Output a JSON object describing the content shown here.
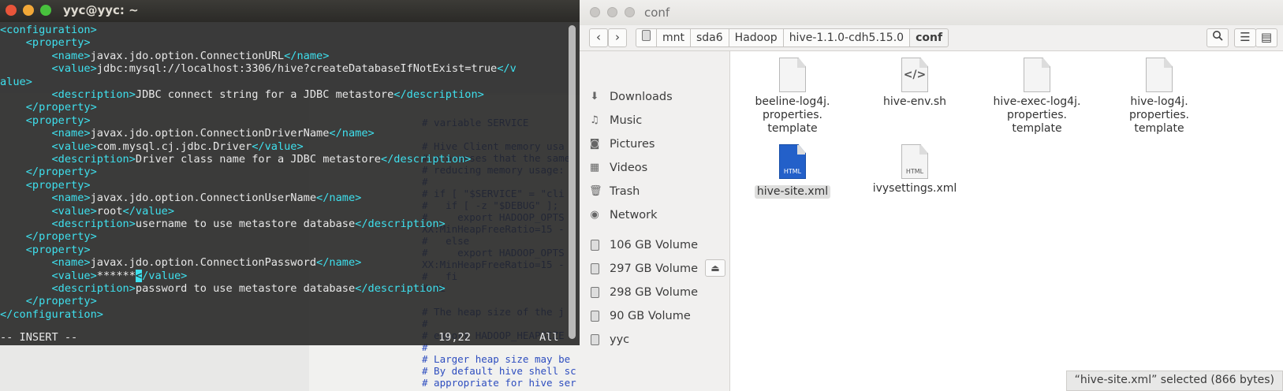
{
  "terminal": {
    "title": "yyc@yyc: ~",
    "lines": [
      {
        "parts": [
          [
            "tag",
            "<configuration>"
          ]
        ]
      },
      {
        "parts": [
          [
            "txt",
            "    "
          ],
          [
            "tag",
            "<property>"
          ]
        ]
      },
      {
        "parts": [
          [
            "txt",
            "        "
          ],
          [
            "tag",
            "<name>"
          ],
          [
            "txt",
            "javax.jdo.option.ConnectionURL"
          ],
          [
            "tag",
            "</name>"
          ]
        ]
      },
      {
        "parts": [
          [
            "txt",
            "        "
          ],
          [
            "tag",
            "<value>"
          ],
          [
            "txt",
            "jdbc:mysql://localhost:3306/hive?createDatabaseIfNotExist=true"
          ],
          [
            "tag",
            "</v"
          ]
        ]
      },
      {
        "parts": [
          [
            "tag",
            "alue>"
          ]
        ]
      },
      {
        "parts": [
          [
            "txt",
            "        "
          ],
          [
            "tag",
            "<description>"
          ],
          [
            "txt",
            "JDBC connect string for a JDBC metastore"
          ],
          [
            "tag",
            "</description>"
          ]
        ]
      },
      {
        "parts": [
          [
            "txt",
            "    "
          ],
          [
            "tag",
            "</property>"
          ]
        ]
      },
      {
        "parts": [
          [
            "txt",
            "    "
          ],
          [
            "tag",
            "<property>"
          ]
        ]
      },
      {
        "parts": [
          [
            "txt",
            "        "
          ],
          [
            "tag",
            "<name>"
          ],
          [
            "txt",
            "javax.jdo.option.ConnectionDriverName"
          ],
          [
            "tag",
            "</name>"
          ]
        ]
      },
      {
        "parts": [
          [
            "txt",
            "        "
          ],
          [
            "tag",
            "<value>"
          ],
          [
            "txt",
            "com.mysql.cj.jdbc.Driver"
          ],
          [
            "tag",
            "</value>"
          ]
        ]
      },
      {
        "parts": [
          [
            "txt",
            "        "
          ],
          [
            "tag",
            "<description>"
          ],
          [
            "txt",
            "Driver class name for a JDBC metastore"
          ],
          [
            "tag",
            "</description>"
          ]
        ]
      },
      {
        "parts": [
          [
            "txt",
            "    "
          ],
          [
            "tag",
            "</property>"
          ]
        ]
      },
      {
        "parts": [
          [
            "txt",
            "    "
          ],
          [
            "tag",
            "<property>"
          ]
        ]
      },
      {
        "parts": [
          [
            "txt",
            "        "
          ],
          [
            "tag",
            "<name>"
          ],
          [
            "txt",
            "javax.jdo.option.ConnectionUserName"
          ],
          [
            "tag",
            "</name>"
          ]
        ]
      },
      {
        "parts": [
          [
            "txt",
            "        "
          ],
          [
            "tag",
            "<value>"
          ],
          [
            "txt",
            "root"
          ],
          [
            "tag",
            "</value>"
          ]
        ]
      },
      {
        "parts": [
          [
            "txt",
            "        "
          ],
          [
            "tag",
            "<description>"
          ],
          [
            "txt",
            "username to use metastore database"
          ],
          [
            "tag",
            "</description>"
          ]
        ]
      },
      {
        "parts": [
          [
            "txt",
            "    "
          ],
          [
            "tag",
            "</property>"
          ]
        ]
      },
      {
        "parts": [
          [
            "txt",
            "    "
          ],
          [
            "tag",
            "<property>"
          ]
        ]
      },
      {
        "parts": [
          [
            "txt",
            "        "
          ],
          [
            "tag",
            "<name>"
          ],
          [
            "txt",
            "javax.jdo.option.ConnectionPassword"
          ],
          [
            "tag",
            "</name>"
          ]
        ]
      },
      {
        "parts": [
          [
            "txt",
            "        "
          ],
          [
            "tag",
            "<value>"
          ],
          [
            "txt",
            "******"
          ],
          [
            "cur",
            "<"
          ],
          [
            "tag",
            "/value>"
          ]
        ]
      },
      {
        "parts": [
          [
            "txt",
            "        "
          ],
          [
            "tag",
            "<description>"
          ],
          [
            "txt",
            "password to use metastore database"
          ],
          [
            "tag",
            "</description>"
          ]
        ]
      },
      {
        "parts": [
          [
            "txt",
            "    "
          ],
          [
            "tag",
            "</property>"
          ]
        ]
      },
      {
        "parts": [
          [
            "tag",
            "</configuration>"
          ]
        ]
      }
    ],
    "mode": "-- INSERT --",
    "position": "19,22",
    "scroll": "All"
  },
  "editor_bg_lines": [
    "# variable SERVICE",
    "",
    "# Hive Client memory usa",
    "# processes that the same",
    "# reducing memory usage:",
    "#",
    "# if [ \"$SERVICE\" = \"cli",
    "#   if [ -z \"$DEBUG\" ];",
    "#     export HADOOP_OPTS",
    "XX:MinHeapFreeRatio=15 -",
    "#   else",
    "#     export HADOOP_OPTS",
    "XX:MinHeapFreeRatio=15 -",
    "#   fi",
    "# fi",
    "",
    "# The heap size of the j",
    "#",
    "# export HADOOP_HEAPSIZE",
    "#",
    "# Larger heap size may be",
    "# By default hive shell sc",
    "# appropriate for hive ser"
  ],
  "file_manager": {
    "title": "conf",
    "breadcrumbs": [
      "mnt",
      "sda6",
      "Hadoop",
      "hive-1.1.0-cdh5.15.0",
      "conf"
    ],
    "sidebar": [
      {
        "icon": "download-icon",
        "glyph": "⬇",
        "label": "Downloads"
      },
      {
        "icon": "music-icon",
        "glyph": "♫",
        "label": "Music"
      },
      {
        "icon": "camera-icon",
        "glyph": "◙",
        "label": "Pictures"
      },
      {
        "icon": "video-icon",
        "glyph": "▦",
        "label": "Videos"
      },
      {
        "icon": "trash-icon",
        "glyph": "🗑",
        "label": "Trash"
      },
      {
        "icon": "network-icon",
        "glyph": "◉",
        "label": "Network"
      },
      {
        "icon": "drive-icon",
        "label": "106 GB Volume"
      },
      {
        "icon": "drive-icon",
        "label": "297 GB Volume"
      },
      {
        "icon": "drive-icon",
        "label": "298 GB Volume"
      },
      {
        "icon": "drive-icon",
        "label": "90 GB Volume"
      },
      {
        "icon": "drive-icon",
        "label": "yyc"
      }
    ],
    "files": [
      {
        "name": "beeline-log4j.\nproperties.\ntemplate",
        "kind": "text",
        "tag": ""
      },
      {
        "name": "hive-env.sh",
        "kind": "script",
        "tag": "</>"
      },
      {
        "name": "hive-exec-log4j.\nproperties.\ntemplate",
        "kind": "text",
        "tag": ""
      },
      {
        "name": "hive-log4j.\nproperties.\ntemplate",
        "kind": "text",
        "tag": ""
      },
      {
        "name": "hive-site.xml",
        "kind": "html",
        "tag": "HTML",
        "selected": true
      },
      {
        "name": "ivysettings.xml",
        "kind": "html",
        "tag": "HTML"
      }
    ],
    "status": "“hive-site.xml” selected  (866 bytes)"
  },
  "colors": {
    "tag": "#3ee0ee",
    "terminal_text": "#e8e8e8",
    "selected_file": "#2360c9"
  }
}
